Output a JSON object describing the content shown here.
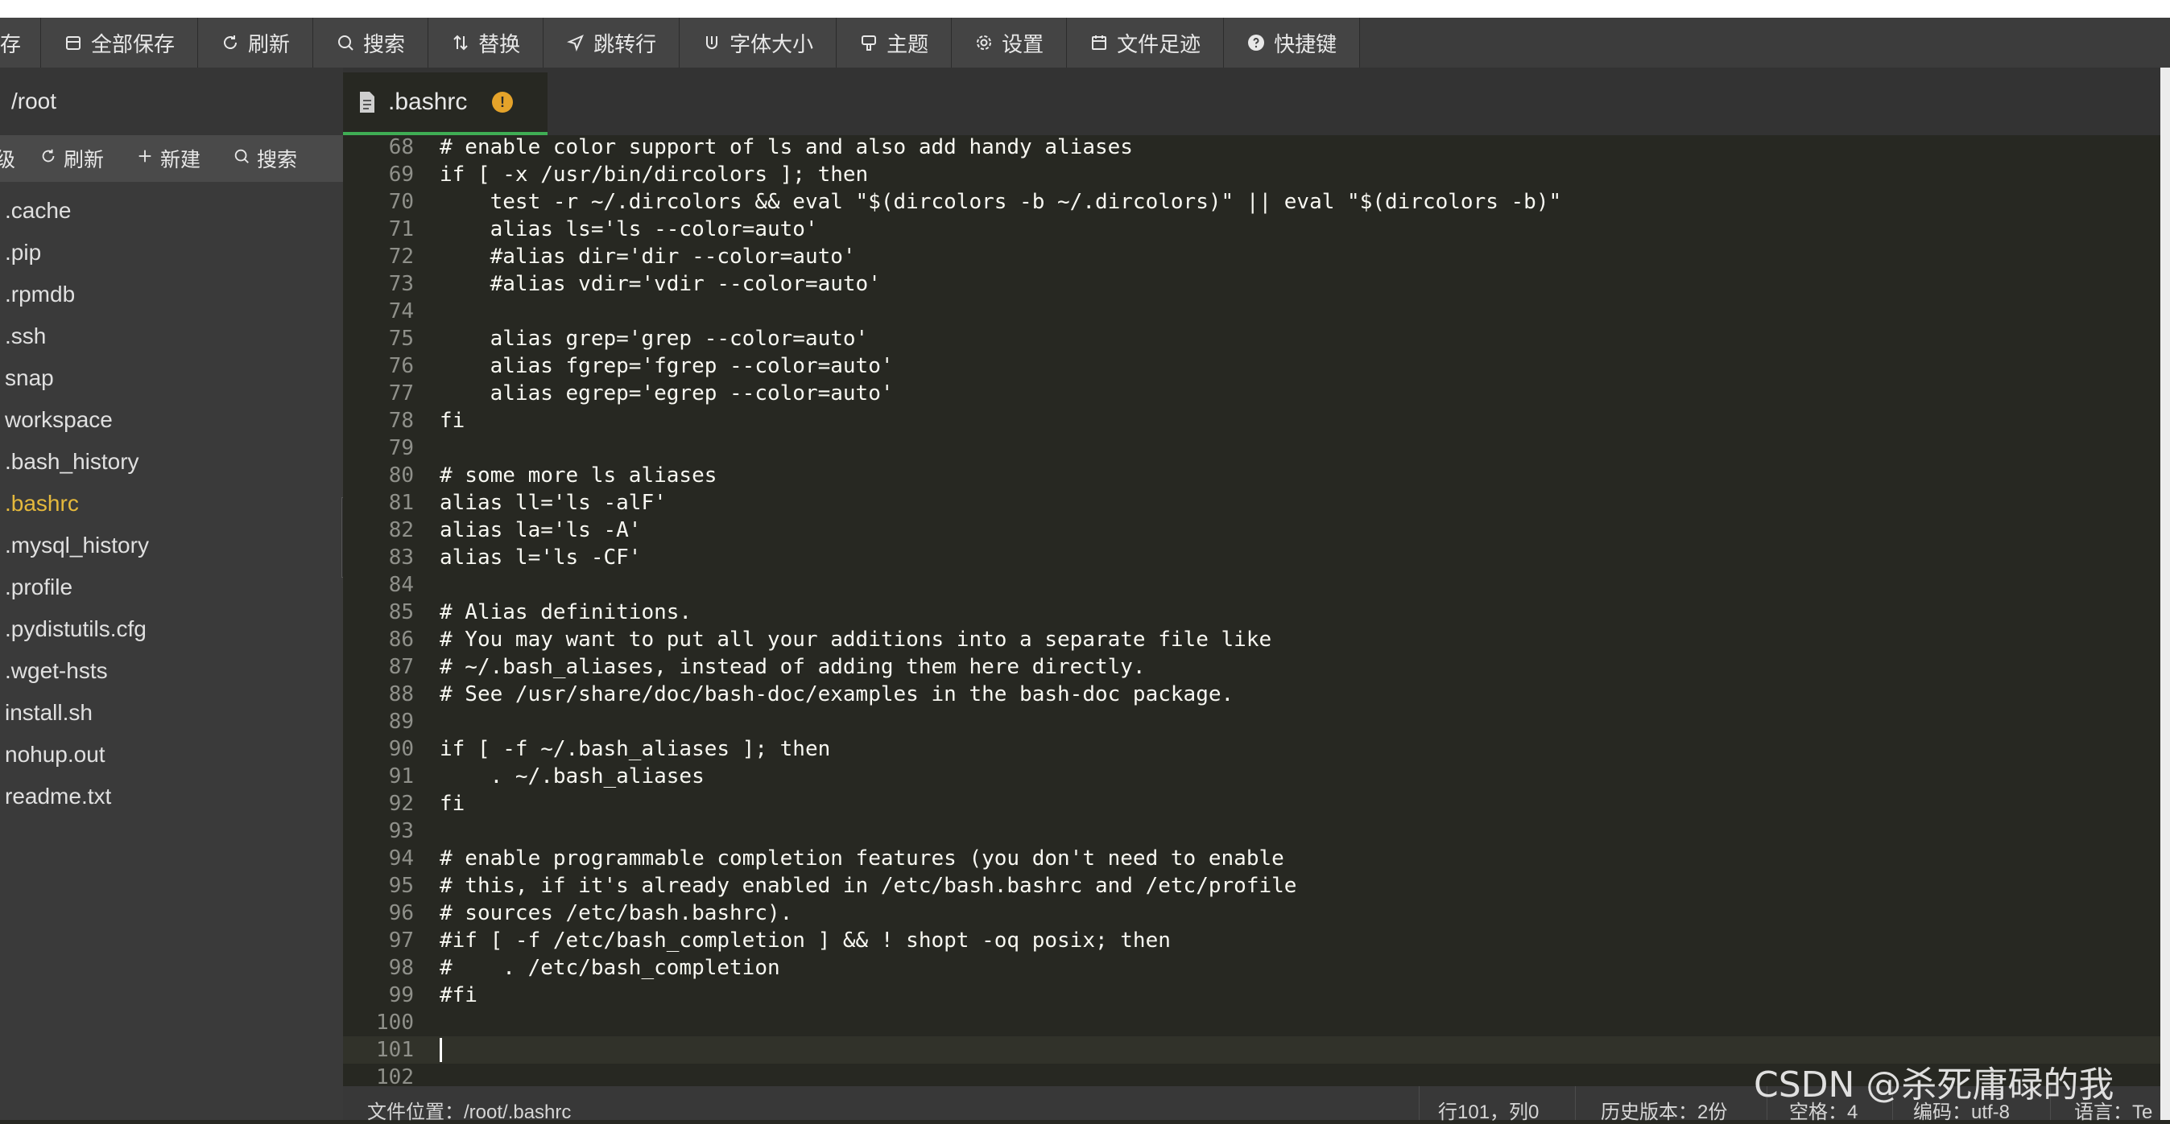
{
  "toolbar": {
    "items": [
      {
        "label": "存",
        "icon": "save-icon"
      },
      {
        "label": "全部保存",
        "icon": "save-all-icon"
      },
      {
        "label": "刷新",
        "icon": "refresh-icon"
      },
      {
        "label": "搜索",
        "icon": "search-icon"
      },
      {
        "label": "替换",
        "icon": "replace-icon"
      },
      {
        "label": "跳转行",
        "icon": "goto-line-icon"
      },
      {
        "label": "字体大小",
        "icon": "font-size-icon"
      },
      {
        "label": "主题",
        "icon": "theme-icon"
      },
      {
        "label": "设置",
        "icon": "gear-icon"
      },
      {
        "label": "文件足迹",
        "icon": "calendar-icon"
      },
      {
        "label": "快捷键",
        "icon": "help-icon"
      }
    ]
  },
  "sidebar": {
    "path": "/root",
    "actions": {
      "up": "级",
      "refresh": "刷新",
      "new": "新建",
      "search": "搜索"
    },
    "files": [
      ".cache",
      ".pip",
      ".rpmdb",
      ".ssh",
      "snap",
      "workspace",
      ".bash_history",
      ".bashrc",
      ".mysql_history",
      ".profile",
      ".pydistutils.cfg",
      ".wget-hsts",
      "install.sh",
      "nohup.out",
      "readme.txt"
    ],
    "active_file": ".bashrc"
  },
  "tab": {
    "name": ".bashrc",
    "warning": "!"
  },
  "editor": {
    "current_line": 101,
    "lines": [
      {
        "n": "68",
        "t": "# enable color support of ls and also add handy aliases"
      },
      {
        "n": "69",
        "t": "if [ -x /usr/bin/dircolors ]; then"
      },
      {
        "n": "70",
        "t": "    test -r ~/.dircolors && eval \"$(dircolors -b ~/.dircolors)\" || eval \"$(dircolors -b)\""
      },
      {
        "n": "71",
        "t": "    alias ls='ls --color=auto'"
      },
      {
        "n": "72",
        "t": "    #alias dir='dir --color=auto'"
      },
      {
        "n": "73",
        "t": "    #alias vdir='vdir --color=auto'"
      },
      {
        "n": "74",
        "t": ""
      },
      {
        "n": "75",
        "t": "    alias grep='grep --color=auto'"
      },
      {
        "n": "76",
        "t": "    alias fgrep='fgrep --color=auto'"
      },
      {
        "n": "77",
        "t": "    alias egrep='egrep --color=auto'"
      },
      {
        "n": "78",
        "t": "fi"
      },
      {
        "n": "79",
        "t": ""
      },
      {
        "n": "80",
        "t": "# some more ls aliases"
      },
      {
        "n": "81",
        "t": "alias ll='ls -alF'"
      },
      {
        "n": "82",
        "t": "alias la='ls -A'"
      },
      {
        "n": "83",
        "t": "alias l='ls -CF'"
      },
      {
        "n": "84",
        "t": ""
      },
      {
        "n": "85",
        "t": "# Alias definitions."
      },
      {
        "n": "86",
        "t": "# You may want to put all your additions into a separate file like"
      },
      {
        "n": "87",
        "t": "# ~/.bash_aliases, instead of adding them here directly."
      },
      {
        "n": "88",
        "t": "# See /usr/share/doc/bash-doc/examples in the bash-doc package."
      },
      {
        "n": "89",
        "t": ""
      },
      {
        "n": "90",
        "t": "if [ -f ~/.bash_aliases ]; then"
      },
      {
        "n": "91",
        "t": "    . ~/.bash_aliases"
      },
      {
        "n": "92",
        "t": "fi"
      },
      {
        "n": "93",
        "t": ""
      },
      {
        "n": "94",
        "t": "# enable programmable completion features (you don't need to enable"
      },
      {
        "n": "95",
        "t": "# this, if it's already enabled in /etc/bash.bashrc and /etc/profile"
      },
      {
        "n": "96",
        "t": "# sources /etc/bash.bashrc)."
      },
      {
        "n": "97",
        "t": "#if [ -f /etc/bash_completion ] && ! shopt -oq posix; then"
      },
      {
        "n": "98",
        "t": "#    . /etc/bash_completion"
      },
      {
        "n": "99",
        "t": "#fi"
      },
      {
        "n": "100",
        "t": ""
      },
      {
        "n": "101",
        "t": ""
      },
      {
        "n": "102",
        "t": ""
      }
    ]
  },
  "status": {
    "file_path": "文件位置：/root/.bashrc",
    "position": "行101，列0",
    "history": "历史版本：2份",
    "spaces": "空格：4",
    "encoding": "编码：utf-8",
    "language": "语言：Te"
  },
  "watermark": "CSDN @杀死庸碌的我",
  "colors": {
    "accent": "#3fae54",
    "active_file": "#e5b93c",
    "warning": "#e5a32a",
    "editor_bg": "#272822"
  }
}
